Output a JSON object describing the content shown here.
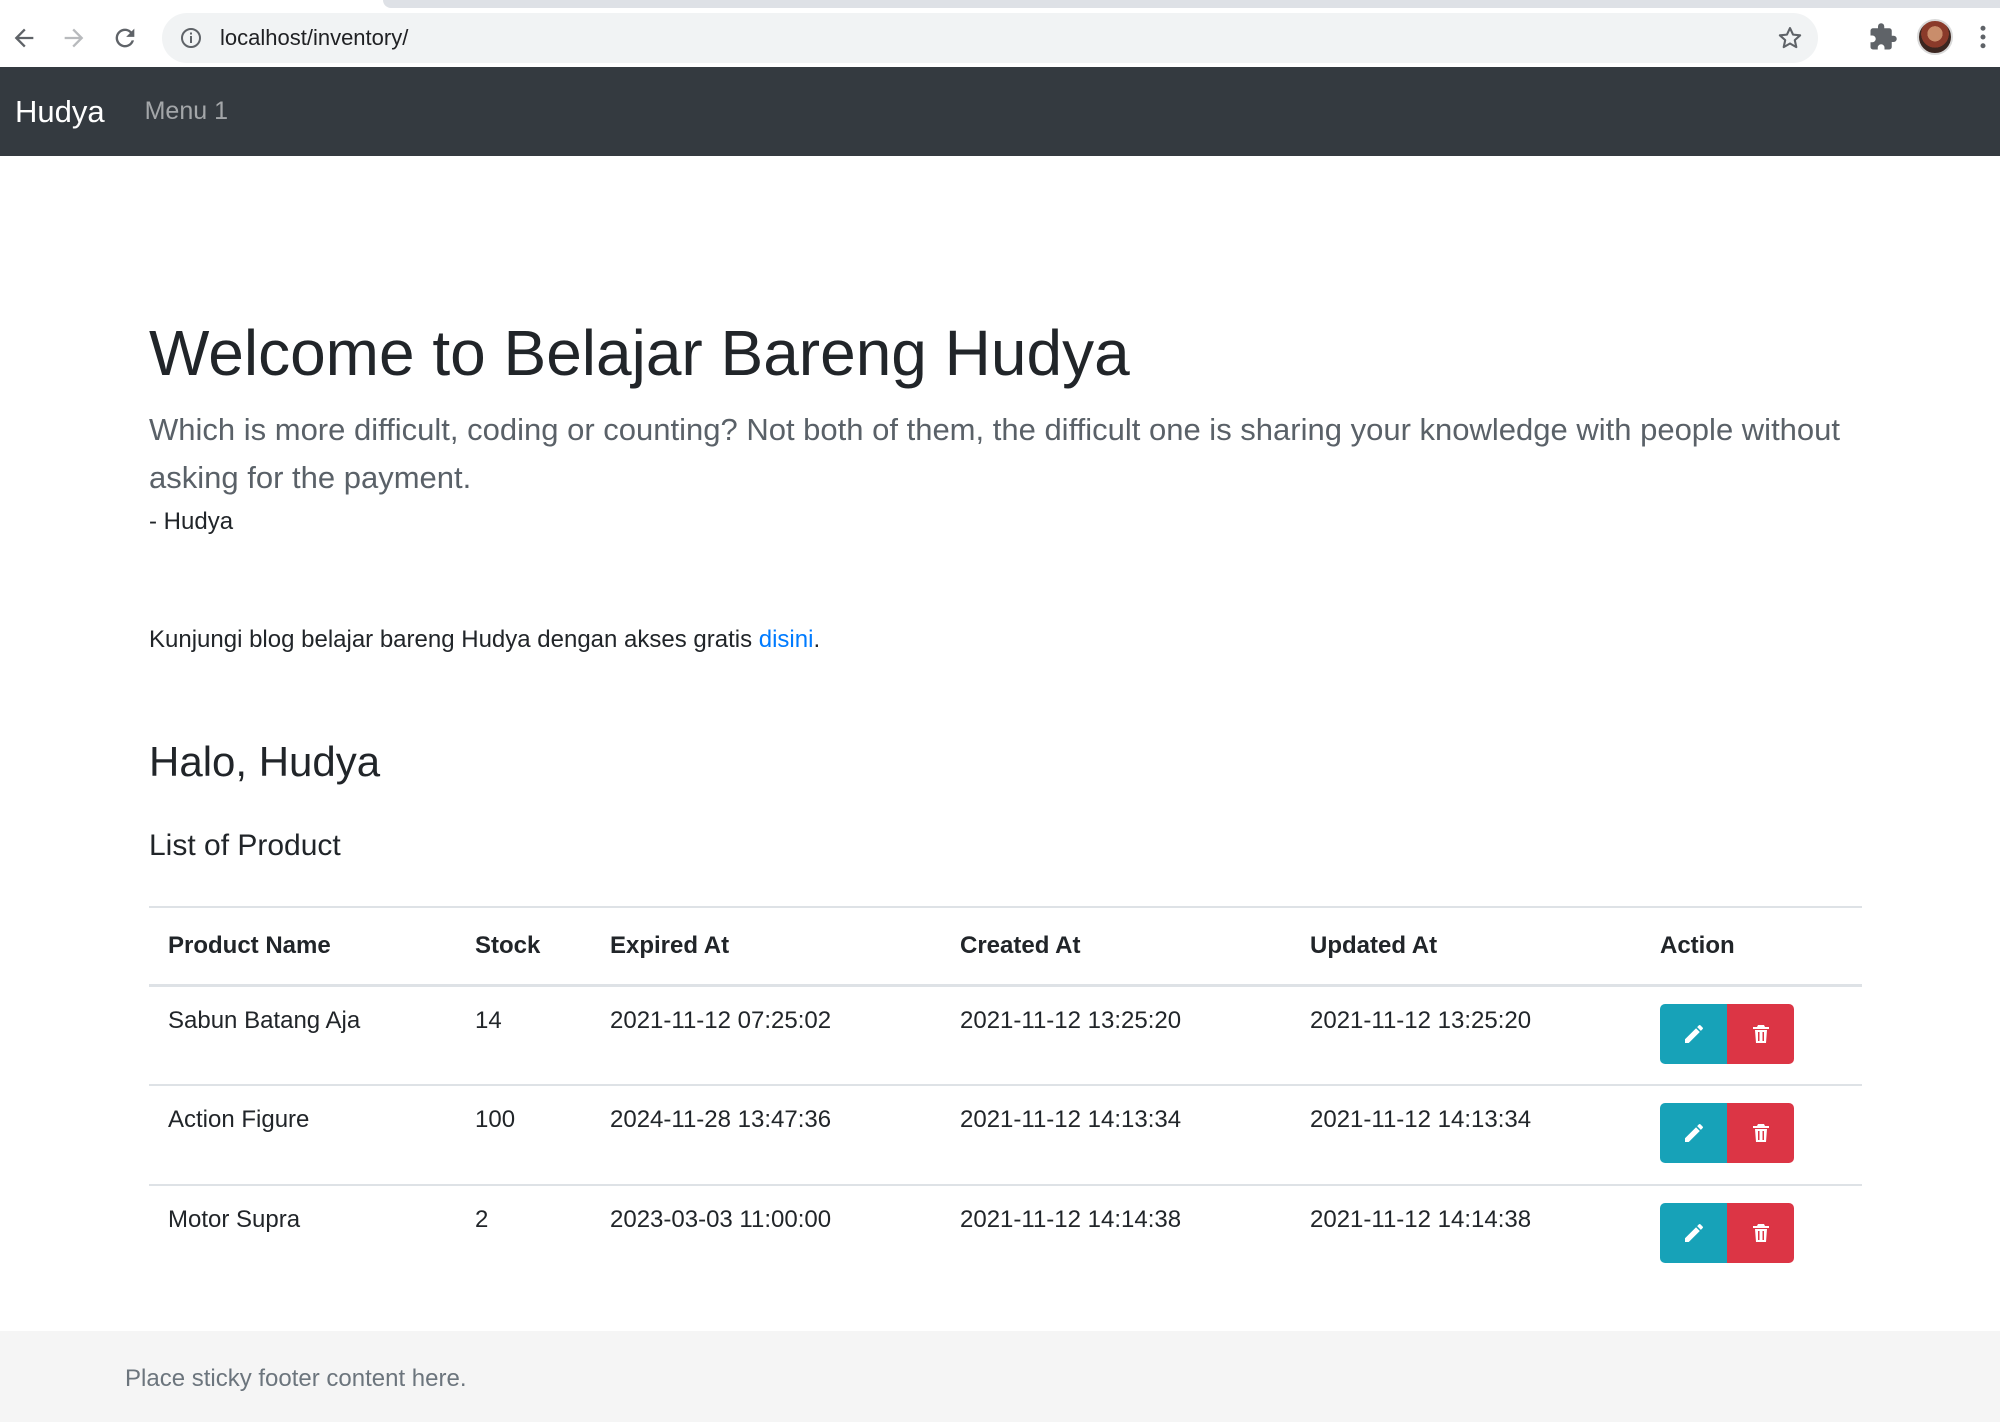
{
  "browser": {
    "url": "localhost/inventory/"
  },
  "navbar": {
    "brand": "Hudya",
    "menu": "Menu 1"
  },
  "hero": {
    "title": "Welcome to Belajar Bareng Hudya",
    "lead": "Which is more difficult, coding or counting? Not both of them, the difficult one is sharing your knowledge with people without asking for the payment.",
    "author": "- Hudya"
  },
  "blog": {
    "text": "Kunjungi blog belajar bareng Hudya dengan akses gratis ",
    "link": "disini",
    "suffix": "."
  },
  "greeting": "Halo, Hudya",
  "list_title": "List of Product",
  "table": {
    "headers": [
      "Product Name",
      "Stock",
      "Expired At",
      "Created At",
      "Updated At",
      "Action"
    ],
    "rows": [
      [
        "Sabun Batang Aja",
        "14",
        "2021-11-12 07:25:02",
        "2021-11-12 13:25:20",
        "2021-11-12 13:25:20"
      ],
      [
        "Action Figure",
        "100",
        "2024-11-28 13:47:36",
        "2021-11-12 14:13:34",
        "2021-11-12 14:13:34"
      ],
      [
        "Motor Supra",
        "2",
        "2023-03-03 11:00:00",
        "2021-11-12 14:14:38",
        "2021-11-12 14:14:38"
      ]
    ]
  },
  "footer": "Place sticky footer content here.",
  "colors": {
    "navbar": "#343a40",
    "edit_button": "#17a2b8",
    "delete_button": "#dc3545",
    "link": "#007bff"
  },
  "icons": {
    "edit": "pencil-icon",
    "delete": "trash-icon"
  }
}
